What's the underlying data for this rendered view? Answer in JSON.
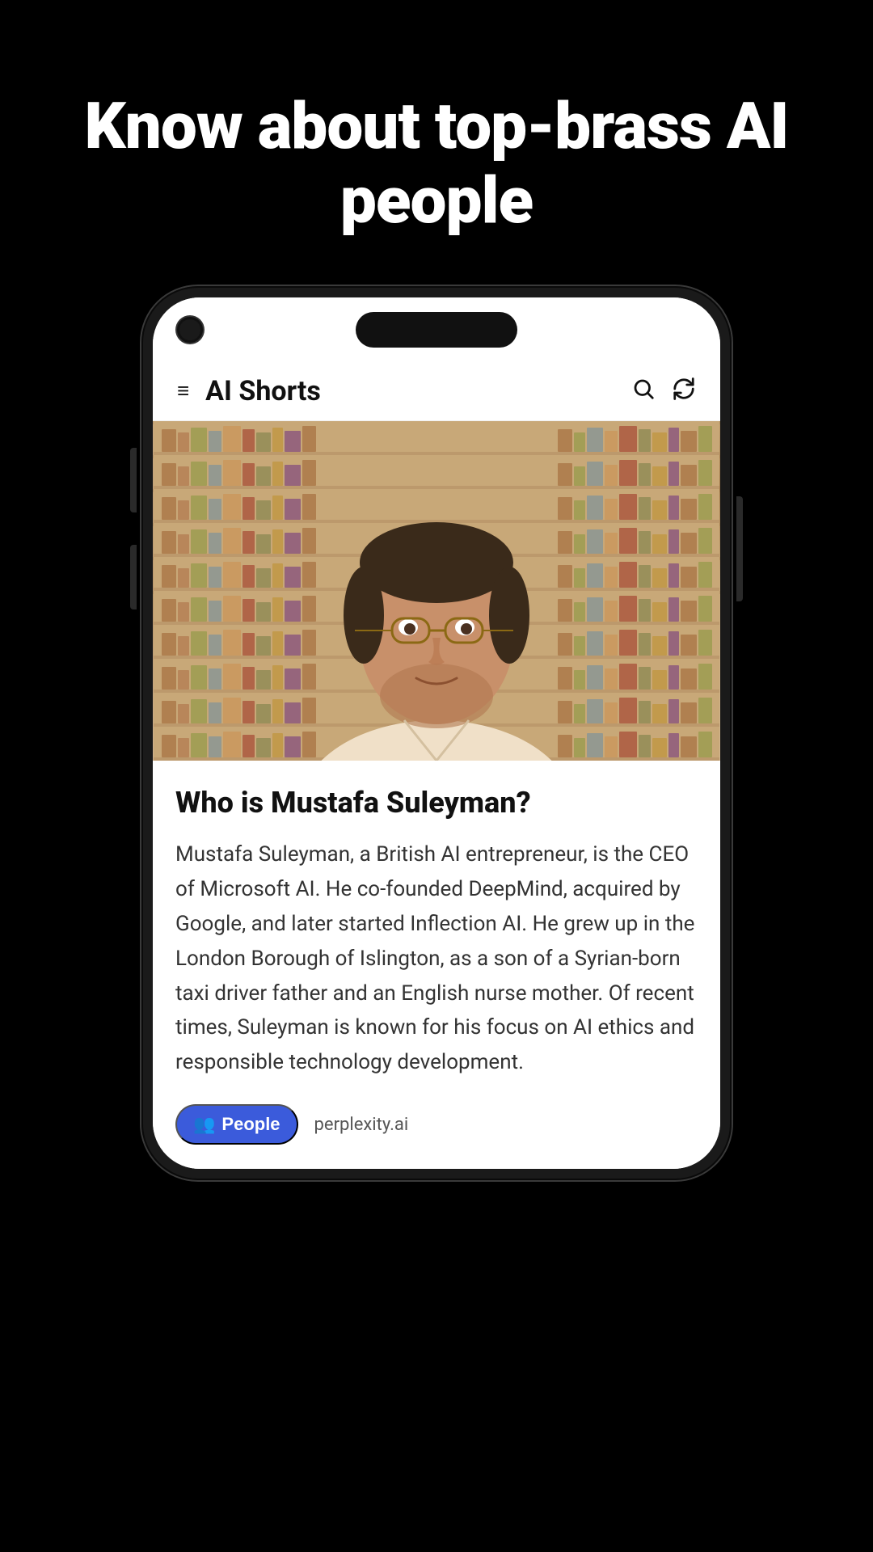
{
  "page": {
    "hero_title": "Know about top-brass AI people",
    "background_color": "#000000"
  },
  "app_bar": {
    "title": "AI Shorts",
    "menu_icon": "≡",
    "search_icon": "⌕",
    "refresh_icon": "↻"
  },
  "article": {
    "title": "Who is Mustafa Suleyman?",
    "body": "Mustafa Suleyman, a British AI entrepreneur, is the CEO of Microsoft AI. He co-founded DeepMind, acquired by Google, and later started Inflection AI. He grew up in the London Borough of Islington, as a son of a Syrian-born taxi driver father and an English nurse mother. Of recent times, Suleyman is known for his focus on AI ethics and responsible technology development.",
    "tag_label": "People",
    "tag_icon": "👥",
    "source": "perplexity.ai"
  },
  "phone": {
    "dynamic_island": true
  }
}
